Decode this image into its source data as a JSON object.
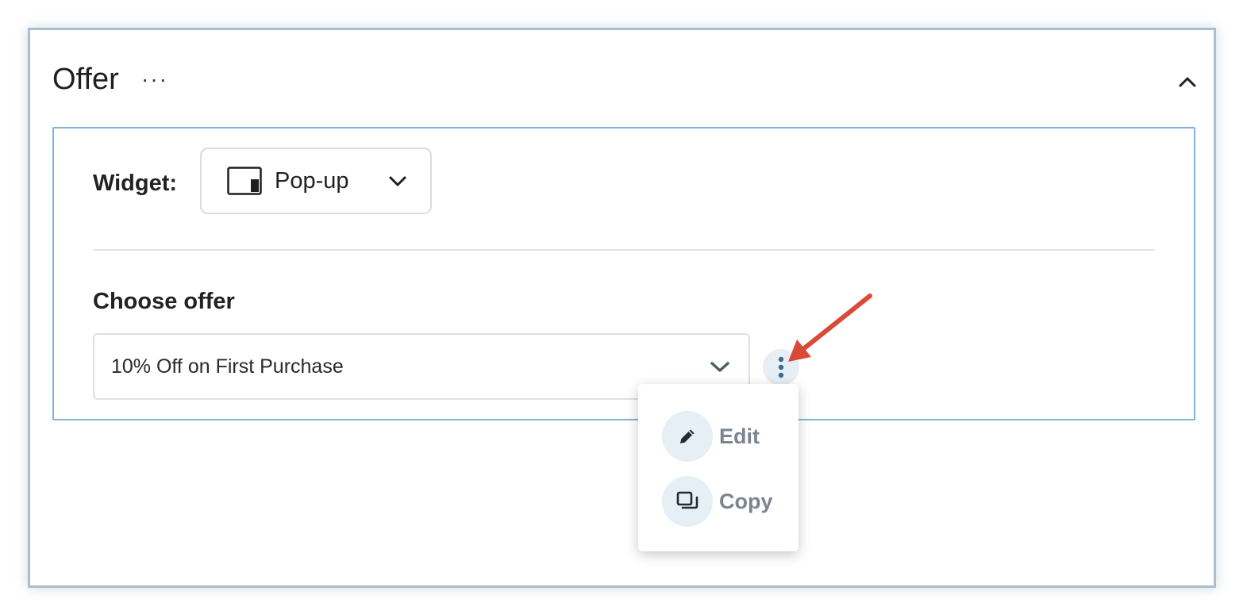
{
  "panel": {
    "title": "Offer",
    "more": "···"
  },
  "widget": {
    "label": "Widget:",
    "selected": "Pop-up",
    "icon": "popup-layout-icon"
  },
  "offer": {
    "label": "Choose offer",
    "selected": "10% Off on First Purchase"
  },
  "menu": {
    "items": [
      {
        "label": "Edit",
        "icon": "pencil-icon"
      },
      {
        "label": "Copy",
        "icon": "copy-icon"
      }
    ]
  },
  "colors": {
    "accent_border": "#7fb2dc",
    "icon_bubble": "#e6eff5",
    "annotation_arrow": "#d94a3a",
    "menu_text": "#7a8591"
  }
}
